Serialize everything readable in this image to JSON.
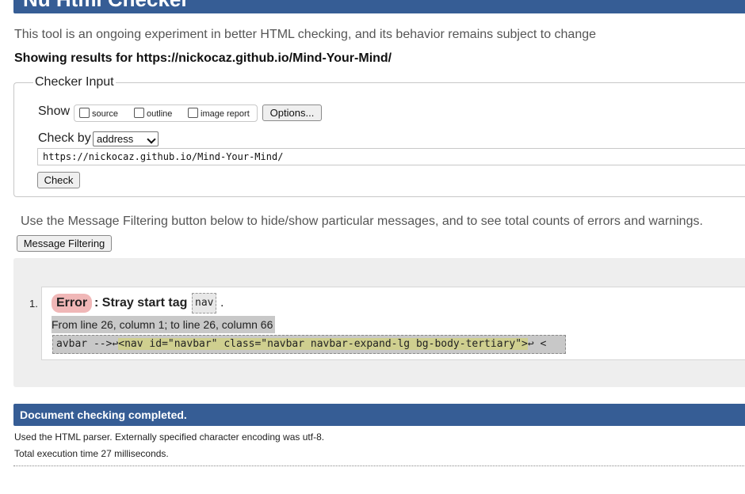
{
  "header": {
    "title": "Nu Html Checker"
  },
  "intro_text": "This tool is an ongoing experiment in better HTML checking, and its behavior remains subject to change",
  "showing_results": {
    "prefix": "Showing results for ",
    "url": "https://nickocaz.github.io/Mind-Your-Mind/"
  },
  "checker_input": {
    "legend": "Checker Input",
    "show_label": "Show",
    "show_options": [
      {
        "label": "source",
        "checked": false
      },
      {
        "label": "outline",
        "checked": false
      },
      {
        "label": "image report",
        "checked": false
      }
    ],
    "options_button": "Options...",
    "check_by_label": "Check by",
    "check_by_value": "address",
    "url_value": "https://nickocaz.github.io/Mind-Your-Mind/",
    "check_button": "Check"
  },
  "filtering": {
    "note": "Use the Message Filtering button below to hide/show particular messages, and to see total counts of errors and warnings.",
    "button": "Message Filtering"
  },
  "results": [
    {
      "number": "1.",
      "type": "Error",
      "separator": ":",
      "message": "Stray start tag",
      "code": "nav",
      "period": ".",
      "location": "From line 26, column 1; to line 26, column 66",
      "extract_pre": "avbar -->↩",
      "extract_highlight": "<nav id=\"navbar\" class=\"navbar navbar-expand-lg bg-body-tertiary\">",
      "extract_post": "↩    <"
    }
  ],
  "completion": {
    "title": "Document checking completed.",
    "parser_note": "Used the HTML parser. Externally specified character encoding was utf-8.",
    "execution_time": "Total execution time 27 milliseconds."
  },
  "colors": {
    "header_blue": "#365d95",
    "error_badge": "#f0b7b7",
    "highlight": "#cfcf8f"
  }
}
